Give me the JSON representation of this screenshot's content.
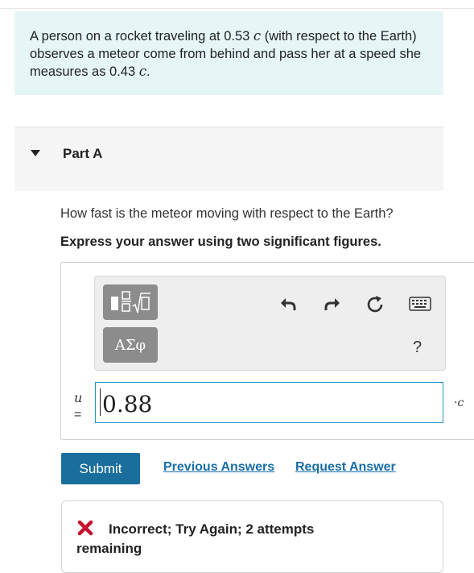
{
  "problem": {
    "text_before_1": "A person on a rocket traveling at 0.53 ",
    "var_1": "c",
    "text_mid": " (with respect to the Earth) observes a meteor come from behind and pass her at a speed she measures as 0.43 ",
    "var_2": "c",
    "text_end": "."
  },
  "part": {
    "title": "Part A"
  },
  "question": "How fast is the meteor moving with respect to the Earth?",
  "instruction": "Express your answer using two significant figures.",
  "toolbar": {
    "greek_label": "ΑΣφ",
    "help_label": "?",
    "icons": [
      "templates-icon",
      "undo-icon",
      "redo-icon",
      "reset-icon",
      "keyboard-icon",
      "help-icon"
    ]
  },
  "answer": {
    "variable": "u",
    "equals": "=",
    "value": "0.88",
    "unit_dot": "·",
    "unit_var": "c"
  },
  "actions": {
    "submit": "Submit",
    "previous_answers": "Previous Answers",
    "request_answer": "Request Answer"
  },
  "feedback": {
    "text": "Incorrect; Try Again; 2 attempts remaining",
    "color": "#c8102e"
  },
  "colors": {
    "problem_bg": "#e6f6f6",
    "submit_bg": "#1a6e9c",
    "link": "#1a6ea8",
    "input_border": "#2196c4"
  }
}
